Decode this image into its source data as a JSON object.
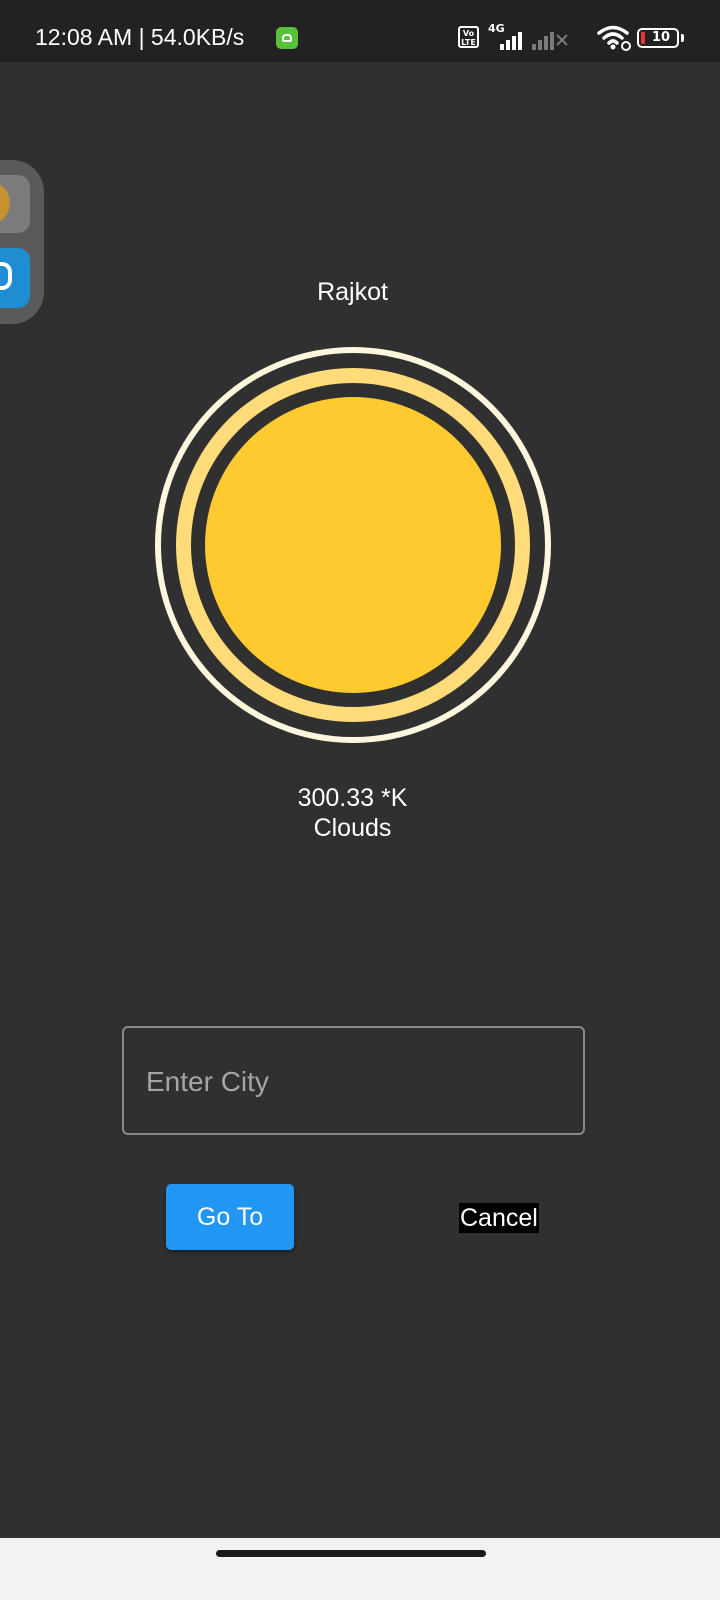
{
  "status_bar": {
    "time_speed": "12:08 AM | 54.0KB/s",
    "network_type": "4G",
    "volte_top": "Vo",
    "volte_bottom": "LTE",
    "battery_level": "10"
  },
  "weather": {
    "city": "Rajkot",
    "temperature": "300.33 *K",
    "condition": "Clouds",
    "sun_icon": "sun-icon",
    "colors": {
      "sun_core": "#ffc930",
      "sun_ring": "#ffdb7a",
      "sun_outer_ring": "#fff6de"
    }
  },
  "form": {
    "city_placeholder": "Enter City",
    "city_value": "",
    "go_label": "Go To",
    "cancel_label": "Cancel"
  },
  "colors": {
    "background": "#303030",
    "accent": "#2196f3"
  }
}
